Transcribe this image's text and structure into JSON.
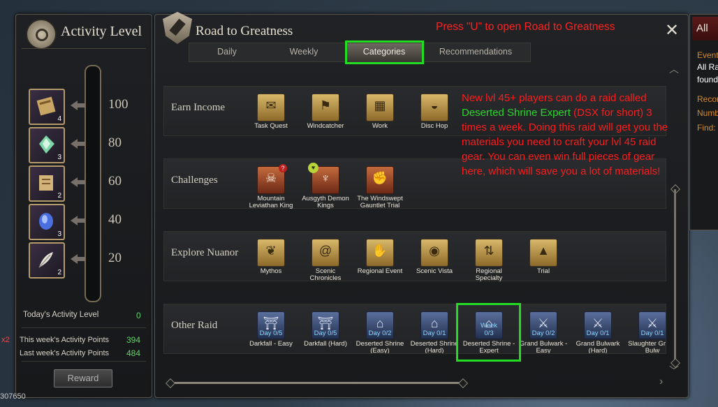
{
  "activity_panel": {
    "title": "Activity Level",
    "levels": [
      "100",
      "80",
      "60",
      "40",
      "20"
    ],
    "reward_items": [
      {
        "icon": "scroll-bundle-icon",
        "count": "4"
      },
      {
        "icon": "green-crystal-icon",
        "count": "3"
      },
      {
        "icon": "map-scroll-icon",
        "count": "2"
      },
      {
        "icon": "blue-gem-icon",
        "count": "3"
      },
      {
        "icon": "feather-icon",
        "count": "2"
      }
    ],
    "today_label": "Today's Activity Level",
    "today_value": "0",
    "this_week_label": "This week's Activity Points",
    "this_week_value": "394",
    "last_week_label": "Last week's Activity Points",
    "last_week_value": "484",
    "reward_button": "Reward"
  },
  "main_panel": {
    "title": "Road to Greatness",
    "hint": "Press \"U\" to open Road to Greatness",
    "tabs": [
      "Daily",
      "Weekly",
      "Categories",
      "Recommendations"
    ],
    "selected_tab": "Categories",
    "categories": [
      {
        "label": "Earn Income",
        "items": [
          {
            "label": "Task Quest",
            "icon": "scroll-icon"
          },
          {
            "label": "Windcatcher",
            "icon": "flag-icon"
          },
          {
            "label": "Work",
            "icon": "map-icon"
          },
          {
            "label": "Disc Hop",
            "icon": "disc-icon"
          }
        ]
      },
      {
        "label": "Challenges",
        "items": [
          {
            "label": "Mountain Leviathan King",
            "icon": "beast-icon"
          },
          {
            "label": "Ausgyth Demon Kings",
            "icon": "demon-icon"
          },
          {
            "label": "The Windswept Gauntlet Trial",
            "icon": "muscle-icon"
          }
        ]
      },
      {
        "label": "Explore Nuanor",
        "items": [
          {
            "label": "Mythos",
            "icon": "mythos-icon"
          },
          {
            "label": "Scenic Chronicles",
            "icon": "swirl-icon"
          },
          {
            "label": "Regional Event",
            "icon": "handshake-icon"
          },
          {
            "label": "Scenic Vista",
            "icon": "vista-icon"
          },
          {
            "label": "Regional Specialty",
            "icon": "specialty-icon"
          },
          {
            "label": "Trial",
            "icon": "grad-cap-icon"
          }
        ]
      },
      {
        "label": "Other Raid",
        "items": [
          {
            "label": "Darkfall - Easy",
            "progress": "Day 0/5",
            "icon": "gate-icon"
          },
          {
            "label": "Darkfall (Hard)",
            "progress": "Day 0/5",
            "icon": "gate-icon"
          },
          {
            "label": "Deserted Shrine (Easy)",
            "progress": "Day 0/2",
            "icon": "shrine-icon"
          },
          {
            "label": "Deserted Shrine (Hard)",
            "progress": "Day 0/1",
            "icon": "shrine-icon"
          },
          {
            "label": "Deserted Shrine - Expert",
            "progress": "Week 0/3",
            "icon": "shrine-icon"
          },
          {
            "label": "Grand Bulwark - Easy",
            "progress": "Day 0/2",
            "icon": "bulwark-icon"
          },
          {
            "label": "Grand Bulwark (Hard)",
            "progress": "Day 0/1",
            "icon": "bulwark-icon"
          },
          {
            "label": "Slaughter Grand Bulw",
            "progress": "Day 0/1",
            "icon": "bulwark-icon"
          }
        ]
      }
    ]
  },
  "annotation": {
    "part1": "New lvl 45+ players can do a raid called ",
    "highlight": "Deserted Shrine Expert",
    "part2": " (DSX for short) 3 times a week. Doing this raid will get you the materials you need to craft your lvl 45 raid gear. You can even win full pieces of gear here, which will save you a lot of materials!"
  },
  "side_panel": {
    "header": "All",
    "lines": [
      "Event",
      "All Ra",
      "found",
      "Recor",
      "Numb",
      "Find:"
    ]
  },
  "status": {
    "bottom_value": "307650",
    "multiplier": "x2"
  }
}
